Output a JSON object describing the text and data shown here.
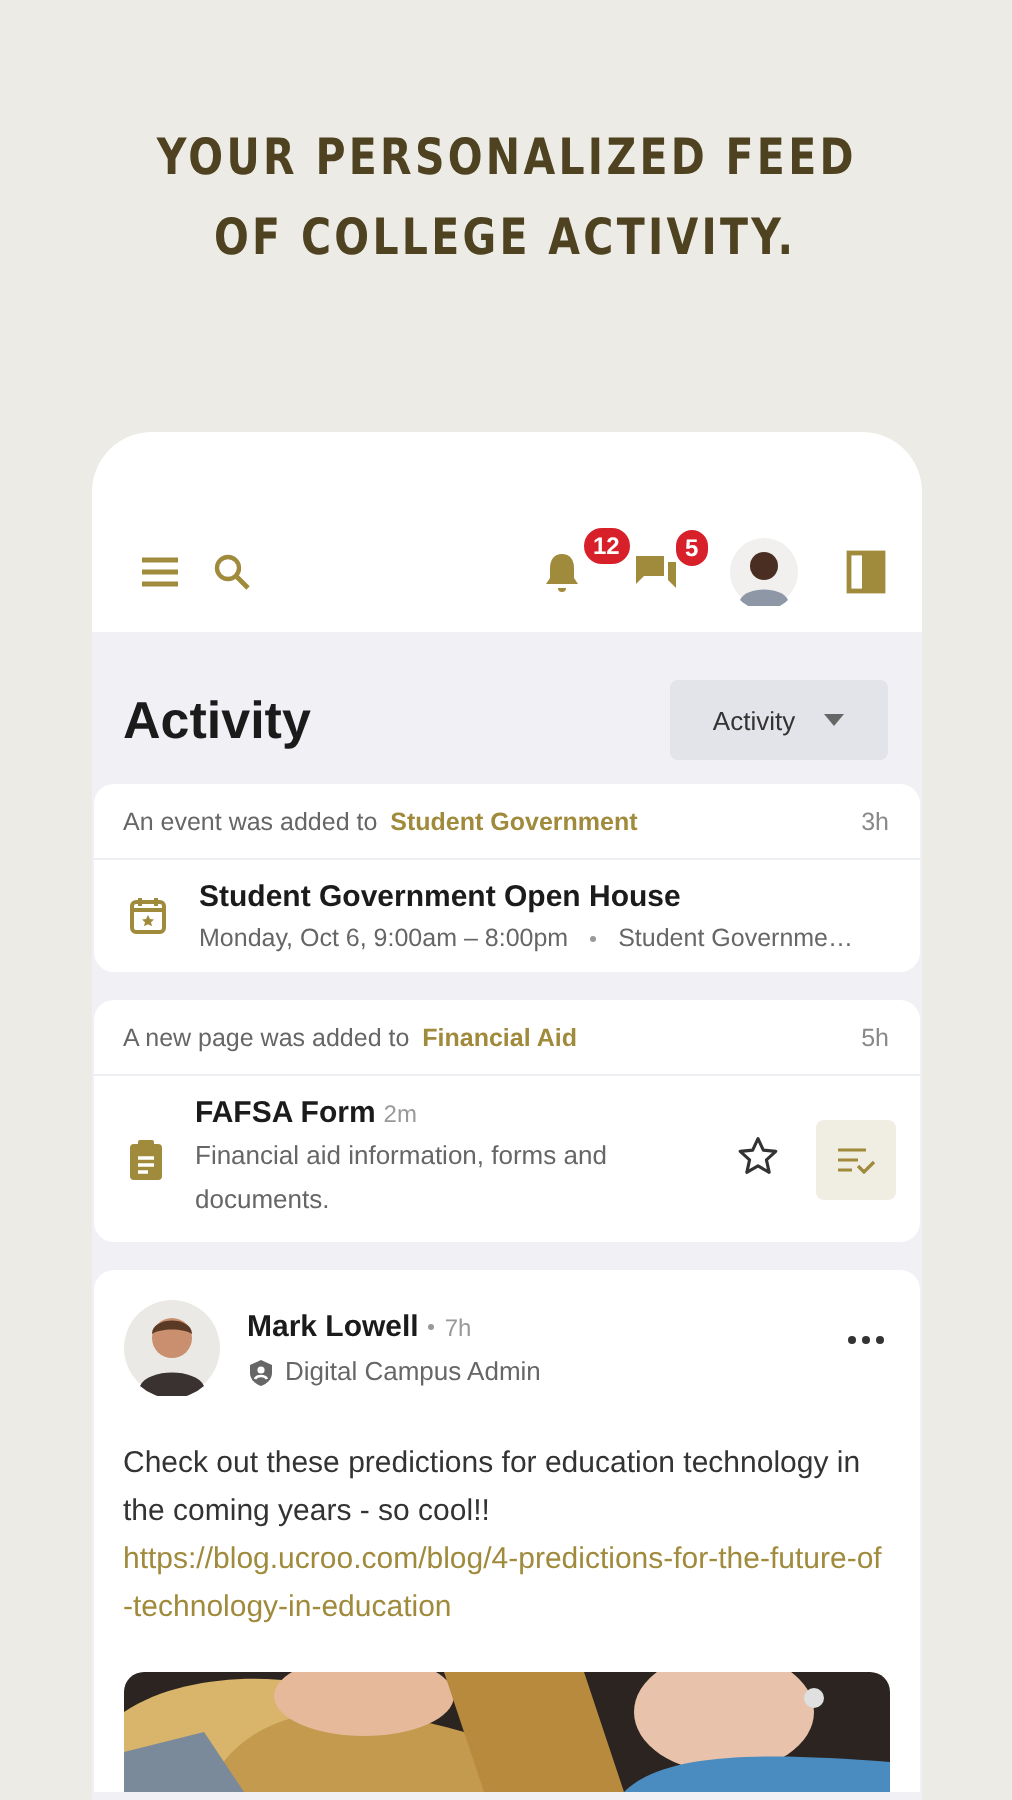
{
  "headline": [
    "YOUR PERSONALIZED FEED",
    "OF COLLEGE ACTIVITY."
  ],
  "topbar": {
    "notifications_badge": "12",
    "messages_badge": "5"
  },
  "page_title": "Activity",
  "filter": {
    "label": "Activity"
  },
  "feed": [
    {
      "kind": "event",
      "header": "An event was added to",
      "group": "Student Government",
      "time": "3h",
      "title": "Student Government Open House",
      "date": "Monday, Oct 6, 9:00am – 8:00pm",
      "location": "Student Governme…"
    },
    {
      "kind": "page",
      "header": "A new page was added to",
      "group": "Financial Aid",
      "time": "5h",
      "title": "FAFSA Form",
      "age": "2m",
      "description": "Financial aid information, forms and documents.",
      "starred": false
    },
    {
      "kind": "post",
      "author": "Mark Lowell",
      "time": "7h",
      "role": "Digital Campus Admin",
      "text": "Check out these predictions for education technology in the coming years - so cool!!",
      "link": "https://blog.ucroo.com/blog/4-predictions-for-the-future-of-technology-in-education"
    }
  ]
}
